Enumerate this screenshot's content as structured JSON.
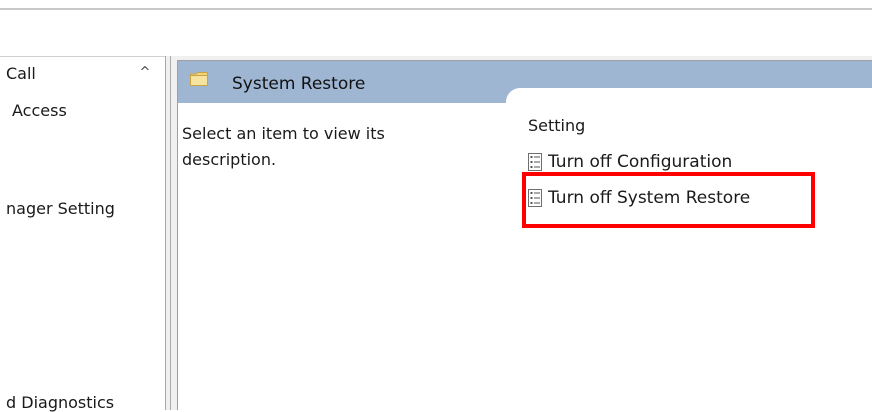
{
  "tree": {
    "items": [
      {
        "label": "Call"
      },
      {
        "label": "Access"
      },
      {
        "label": "nager Setting"
      },
      {
        "label": "d Diagnostics"
      }
    ],
    "scroll_up_glyph": "^"
  },
  "header": {
    "icon": "folder-icon",
    "title": "System Restore"
  },
  "details": {
    "description": "Select an item to view its description.",
    "column_header": "Setting",
    "settings": [
      {
        "icon": "policy-setting-icon",
        "label": "Turn off Configuration"
      },
      {
        "icon": "policy-setting-icon",
        "label": "Turn off System Restore"
      }
    ]
  },
  "annotation": {
    "highlight_color": "#ff0000"
  },
  "colors": {
    "header_bar": "#9fb6d3",
    "folder": "#f2d37a"
  }
}
